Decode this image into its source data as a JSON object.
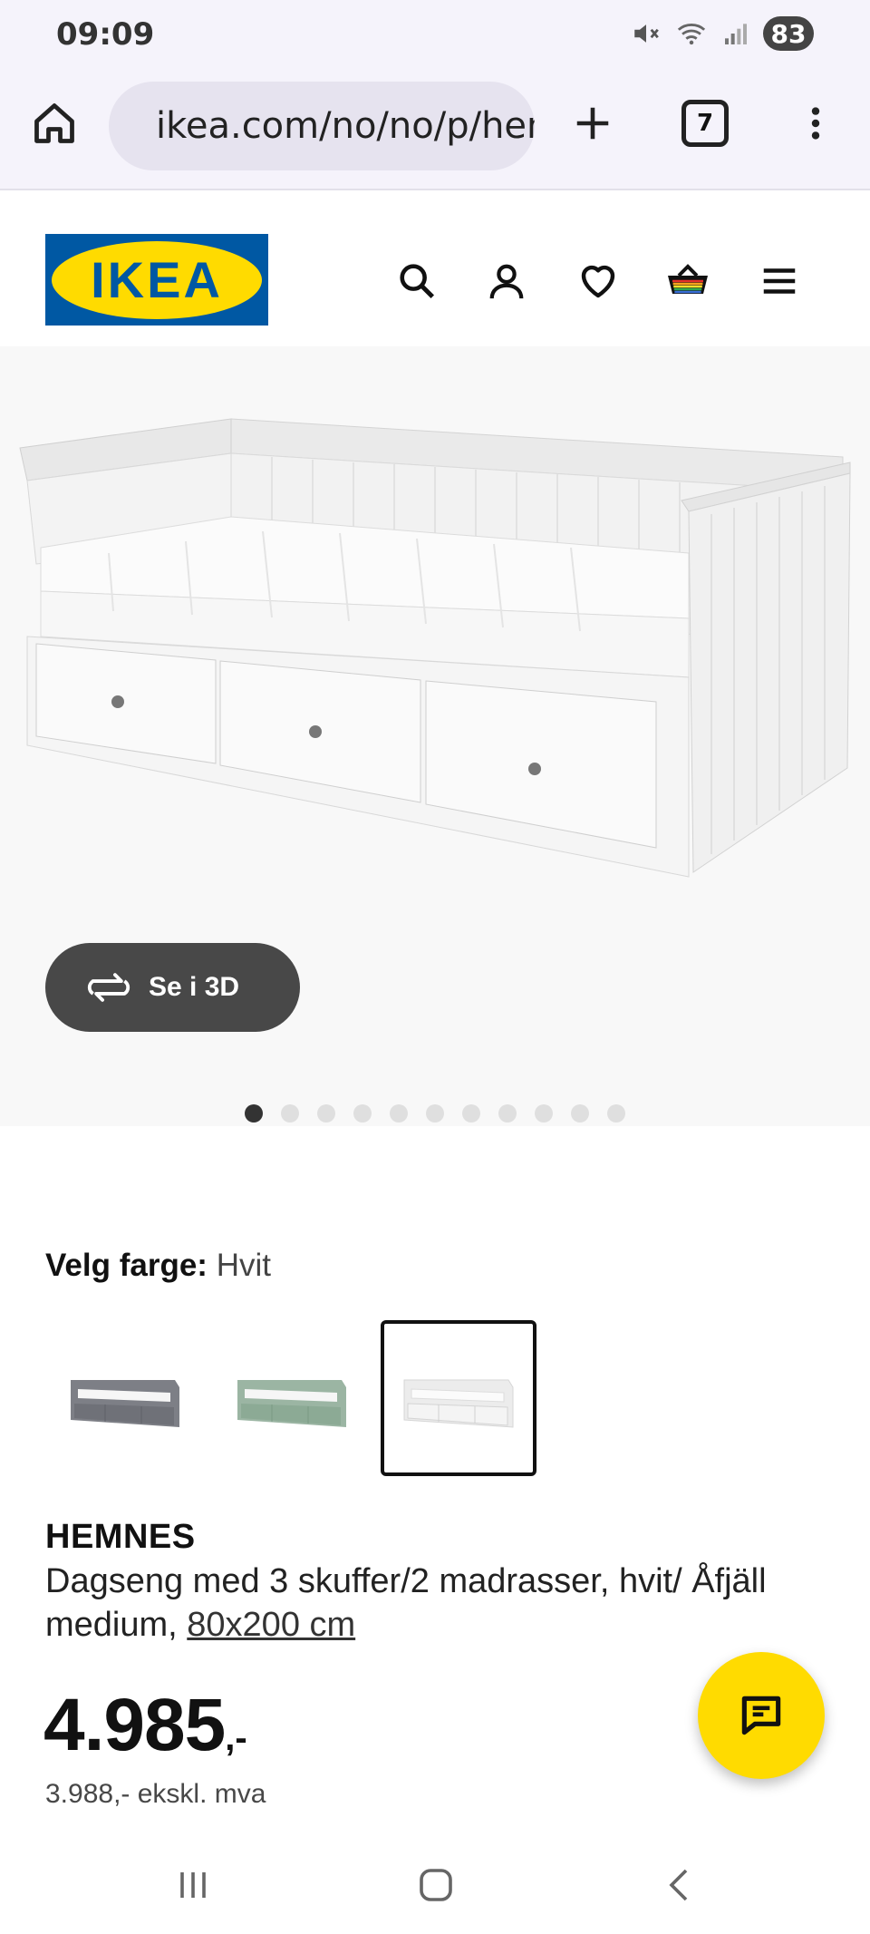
{
  "status_bar": {
    "time": "09:09",
    "battery": "83",
    "icons": [
      "mute-icon",
      "wifi-icon",
      "signal-icon"
    ]
  },
  "browser": {
    "url": "ikea.com/no/no/p/hemnes",
    "tab_count": "7",
    "icons": [
      "home-icon",
      "site-settings-icon",
      "new-tab-icon",
      "tab-switcher",
      "more-vert-icon"
    ]
  },
  "header": {
    "logo_text": "IKEA",
    "icons": [
      "search-icon",
      "account-icon",
      "heart-icon",
      "basket-icon",
      "hamburger-menu-icon"
    ],
    "colors": {
      "logo_blue": "#0058a3",
      "logo_yellow": "#ffdb00"
    }
  },
  "gallery": {
    "view_3d_label": "Se i 3D",
    "dot_count": 11,
    "active_dot": 0
  },
  "color_select": {
    "label": "Velg farge:",
    "value": "Hvit",
    "swatches": [
      {
        "name": "grey",
        "color": "#7d7f86",
        "selected": false
      },
      {
        "name": "green",
        "color": "#9bb5a3",
        "selected": false
      },
      {
        "name": "white",
        "color": "#f4f4f4",
        "selected": true
      }
    ]
  },
  "product": {
    "name": "HEMNES",
    "description": "Dagseng med 3 skuffer/2 madrasser, hvit/ Åfjäll medium, ",
    "size": "80x200 cm",
    "price": "4.985",
    "price_suffix": ",-",
    "price_ex_vat": "3.988,- ekskl. mva"
  },
  "chat": {
    "icon": "chat-icon",
    "color": "#ffdb00"
  },
  "nav": {
    "icons": [
      "recents-icon",
      "home-nav-icon",
      "back-icon"
    ]
  }
}
